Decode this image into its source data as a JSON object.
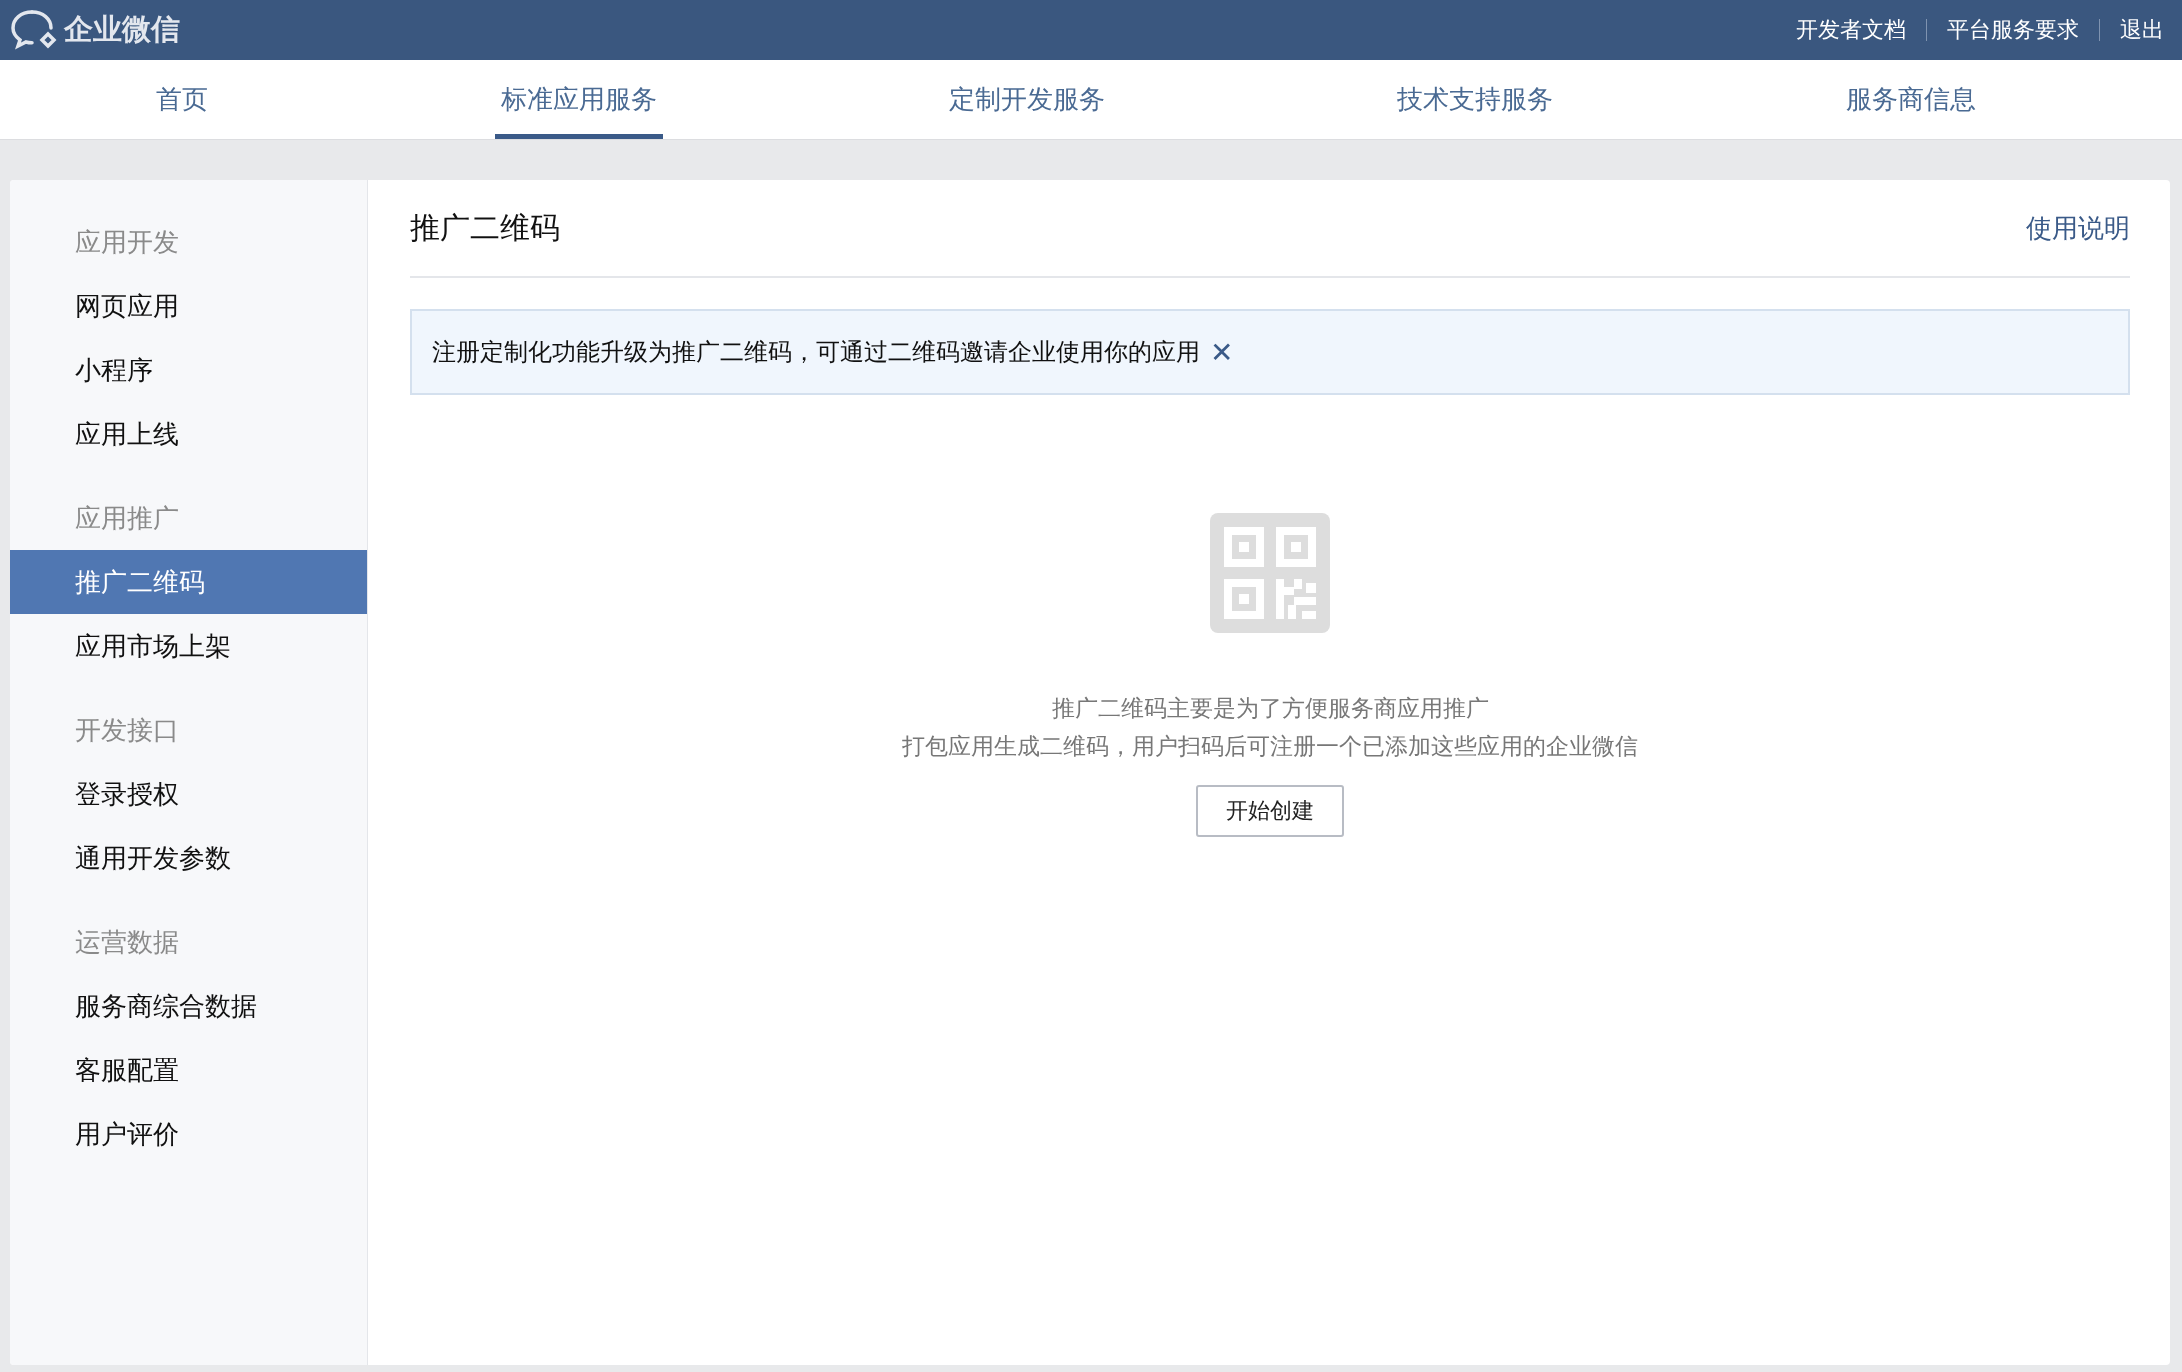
{
  "header": {
    "logo": "企业微信",
    "links": [
      "开发者文档",
      "平台服务要求",
      "退出"
    ]
  },
  "nav_tabs": [
    {
      "label": "首页",
      "selected": false
    },
    {
      "label": "标准应用服务",
      "selected": true
    },
    {
      "label": "定制开发服务",
      "selected": false
    },
    {
      "label": "技术支持服务",
      "selected": false
    },
    {
      "label": "服务商信息",
      "selected": false
    }
  ],
  "sidebar": {
    "groups": [
      {
        "title": "应用开发",
        "items": [
          {
            "label": "网页应用",
            "selected": false
          },
          {
            "label": "小程序",
            "selected": false
          },
          {
            "label": "应用上线",
            "selected": false
          }
        ]
      },
      {
        "title": "应用推广",
        "items": [
          {
            "label": "推广二维码",
            "selected": true
          },
          {
            "label": "应用市场上架",
            "selected": false
          }
        ]
      },
      {
        "title": "开发接口",
        "items": [
          {
            "label": "登录授权",
            "selected": false
          },
          {
            "label": "通用开发参数",
            "selected": false
          }
        ]
      },
      {
        "title": "运营数据",
        "items": [
          {
            "label": "服务商综合数据",
            "selected": false
          },
          {
            "label": "客服配置",
            "selected": false
          },
          {
            "label": "用户评价",
            "selected": false
          }
        ]
      }
    ]
  },
  "content": {
    "title": "推广二维码",
    "help_link": "使用说明",
    "notice": {
      "text": "注册定制化功能升级为推广二维码，可通过二维码邀请企业使用你的应用",
      "close": "✕"
    },
    "empty_state": {
      "lines": [
        "推广二维码主要是为了方便服务商应用推广",
        "打包应用生成二维码，用户扫码后可注册一个已添加这些应用的企业微信"
      ],
      "button": "开始创建"
    }
  }
}
